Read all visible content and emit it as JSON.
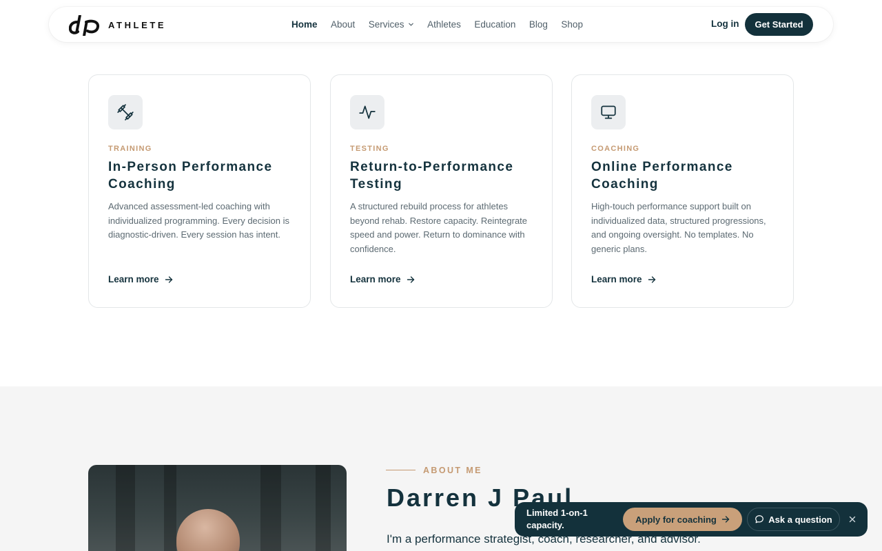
{
  "nav": {
    "brand": "ATHLETE",
    "links": [
      {
        "label": "Home",
        "active": true
      },
      {
        "label": "About"
      },
      {
        "label": "Services"
      },
      {
        "label": "Athletes"
      },
      {
        "label": "Education"
      },
      {
        "label": "Blog"
      },
      {
        "label": "Shop"
      }
    ],
    "login": "Log in",
    "cta": "Get Started"
  },
  "cards": [
    {
      "icon": "dumbbell-icon",
      "tag": "TRAINING",
      "title": "In-Person Performance Coaching",
      "description": "Advanced assessment-led coaching with individualized programming. Every decision is diagnostic-driven. Every session has intent.",
      "link": "Learn more"
    },
    {
      "icon": "activity-icon",
      "tag": "TESTING",
      "title": "Return-to-Performance Testing",
      "description": "A structured rebuild process for athletes beyond rehab. Restore capacity. Reintegrate speed and power. Return to dominance with confidence.",
      "link": "Learn more"
    },
    {
      "icon": "monitor-icon",
      "tag": "COACHING",
      "title": "Online Performance Coaching",
      "description": "High-touch performance support built on individualized data, structured progressions, and ongoing oversight. No templates. No generic plans.",
      "link": "Learn more"
    }
  ],
  "about": {
    "label": "ABOUT ME",
    "name": "Darren J Paul",
    "intro": "I'm a performance strategist, coach, researcher, and advisor."
  },
  "float_bar": {
    "text": "Limited 1-on-1 capacity.",
    "apply": "Apply for coaching",
    "ask": "Ask a question"
  },
  "colors": {
    "primary": "#13313b",
    "accent": "#c59a72",
    "section_bg": "#f5f5f5"
  }
}
